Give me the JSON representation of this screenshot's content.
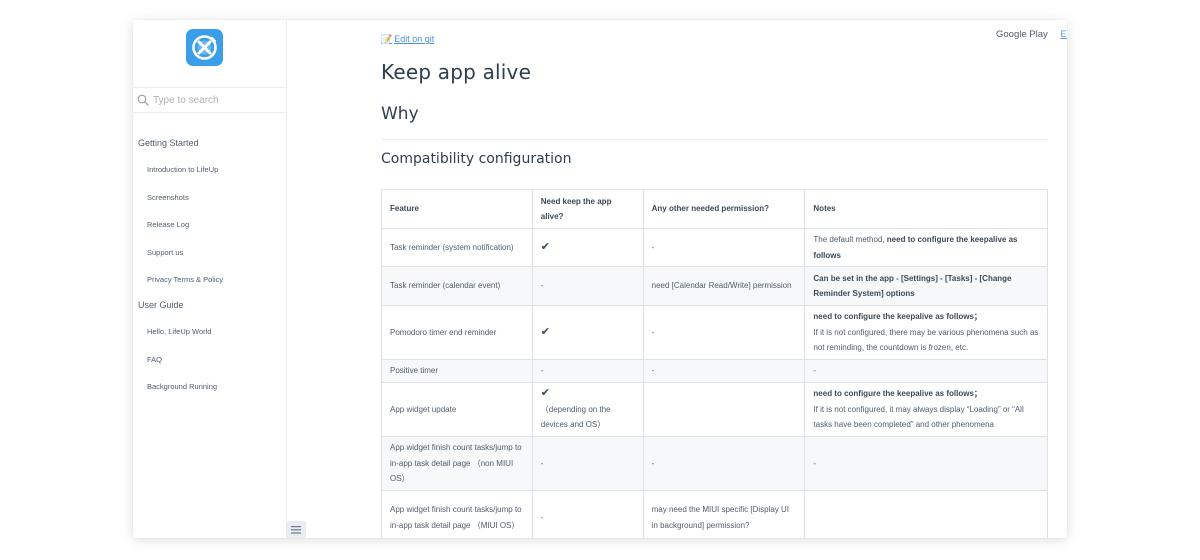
{
  "sidebar": {
    "search_placeholder": "Type to search",
    "sections": [
      {
        "title": "Getting Started",
        "items": [
          "Introduction to LifeUp",
          "Screenshots",
          "Release Log",
          "Support us",
          "Privacy Terms & Policy"
        ]
      },
      {
        "title": "User Guide",
        "items": [
          "Hello, LifeUp World",
          "FAQ",
          "Background Running"
        ]
      }
    ]
  },
  "topnav": {
    "google_play": "Google Play",
    "language": "En"
  },
  "content": {
    "edit_link": "Edit on git",
    "title": "Keep app alive",
    "why": "Why",
    "compat_heading": "Compatibility configuration",
    "table": {
      "headers": [
        "Feature",
        "Need keep the app alive?",
        "Any other needed permission?",
        "Notes"
      ],
      "rows": [
        {
          "feature": "Task reminder (system notification)",
          "keep": "check",
          "keep_extra": "",
          "permission": "-",
          "notes_plain": "The default method, ",
          "notes_bold": "need to configure the keepalive as follows",
          "notes_after": ""
        },
        {
          "feature": "Task reminder (calendar event)",
          "keep": "-",
          "keep_extra": "",
          "permission": "need [Calendar Read/Write] permission",
          "notes_plain": "",
          "notes_bold": "Can be set in the app - [Settings] - [Tasks] - [Change Reminder System] options",
          "notes_after": ""
        },
        {
          "feature": "Pomodoro timer end reminder",
          "keep": "check",
          "keep_extra": "",
          "permission": "-",
          "notes_plain": "",
          "notes_bold": "need to configure the keepalive as follows；",
          "notes_after": "If it is not configured, there may be various phenomena such as not reminding, the countdown is frozen, etc."
        },
        {
          "feature": "Positive timer",
          "keep": "-",
          "keep_extra": "",
          "permission": "-",
          "notes_plain": "-",
          "notes_bold": "",
          "notes_after": ""
        },
        {
          "feature": "App widget update",
          "keep": "check",
          "keep_extra": "（depending on the devices and OS）",
          "permission": "",
          "notes_plain": "",
          "notes_bold": "need to configure the keepalive as follows；",
          "notes_after": "If it is not configured, it may always display “Loading” or “All tasks have been completed” and other phenomena"
        },
        {
          "feature": "App widget finish count tasks/jump to in-app task detail page （non MIUI OS）",
          "keep": "-",
          "keep_extra": "",
          "permission": "-",
          "notes_plain": "-",
          "notes_bold": "",
          "notes_after": ""
        },
        {
          "feature": "App widget finish count tasks/jump to in-app task detail page （MIUI OS）",
          "keep": "-",
          "keep_extra": "",
          "permission": "may need the MIUI specific [Display UI in background] permission?",
          "notes_plain": "",
          "notes_bold": "",
          "notes_after": ""
        }
      ]
    }
  },
  "colors": {
    "link": "#4a90d9",
    "logo_bg": "#3a9ee8",
    "text": "#505d6b"
  }
}
